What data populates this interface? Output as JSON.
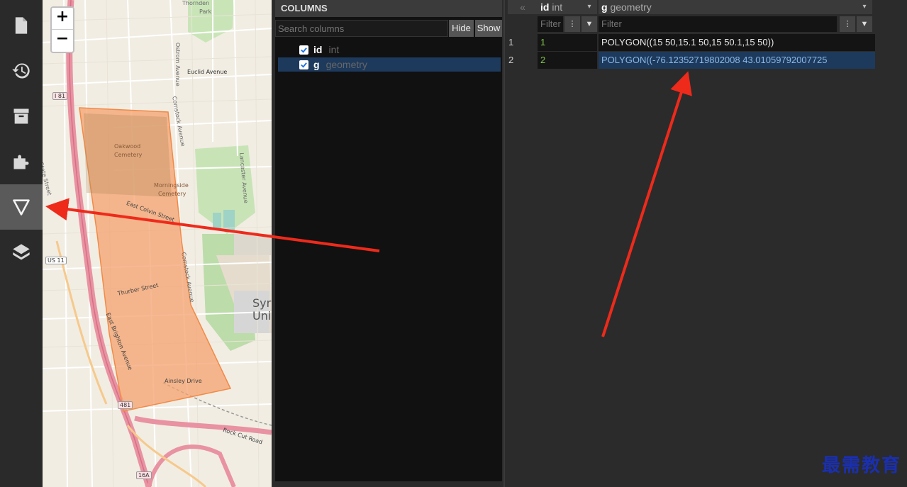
{
  "sidebar": {
    "items": [
      {
        "name": "file-icon",
        "active": false
      },
      {
        "name": "history-icon",
        "active": false
      },
      {
        "name": "archive-icon",
        "active": false
      },
      {
        "name": "puzzle-icon",
        "active": false
      },
      {
        "name": "filter-triangle-icon",
        "active": true
      },
      {
        "name": "layers-icon",
        "active": false
      }
    ]
  },
  "map": {
    "zoom_in": "+",
    "zoom_out": "−",
    "labels": {
      "thornden": "Thornden",
      "park": "Park",
      "ostrom": "Ostrom Avenue",
      "euclid": "Euclid Avenue",
      "oakwood": "Oakwood",
      "cemetery1": "Cemetery",
      "morningside": "Morningside",
      "cemetery2": "Cemetery",
      "colvin": "East Colvin Street",
      "comstock1": "Comstock Avenue",
      "comstock2": "Comstock Avenue",
      "lancaster": "Lancaster Avenue",
      "state": "State Street",
      "thurber": "Thurber Street",
      "brighton": "East Brighton Avenue",
      "ainsley": "Ainsley Drive",
      "rockcut": "Rock Cut Road",
      "syr": "Syr",
      "uni": "Uni",
      "i81": "I 81",
      "us11": "US 11",
      "i481": "481",
      "r16a": "16A"
    },
    "polygon_color": "#f4a26f"
  },
  "columns_panel": {
    "title": "COLUMNS",
    "search_placeholder": "Search columns",
    "hide_label": "Hide",
    "show_label": "Show",
    "columns": [
      {
        "name": "id",
        "type": "int",
        "checked": true,
        "selected": false
      },
      {
        "name": "g",
        "type": "geometry",
        "checked": true,
        "selected": true
      }
    ]
  },
  "grid": {
    "collapse_label": "«",
    "headers": [
      {
        "name": "id",
        "type": "int"
      },
      {
        "name": "g",
        "type": "geometry"
      }
    ],
    "filter_placeholder": "Filter",
    "rows": [
      {
        "num": "1",
        "id": "1",
        "g": "POLYGON((15 50,15.1 50,15 50.1,15 50))"
      },
      {
        "num": "2",
        "id": "2",
        "g": "POLYGON((-76.12352719802008 43.01059792007725"
      }
    ]
  },
  "watermark": "最需教育",
  "colors": {
    "accent_selected": "#1d3a5c",
    "int_value": "#7fc24a",
    "annotation_arrow": "#ee2a1b"
  }
}
